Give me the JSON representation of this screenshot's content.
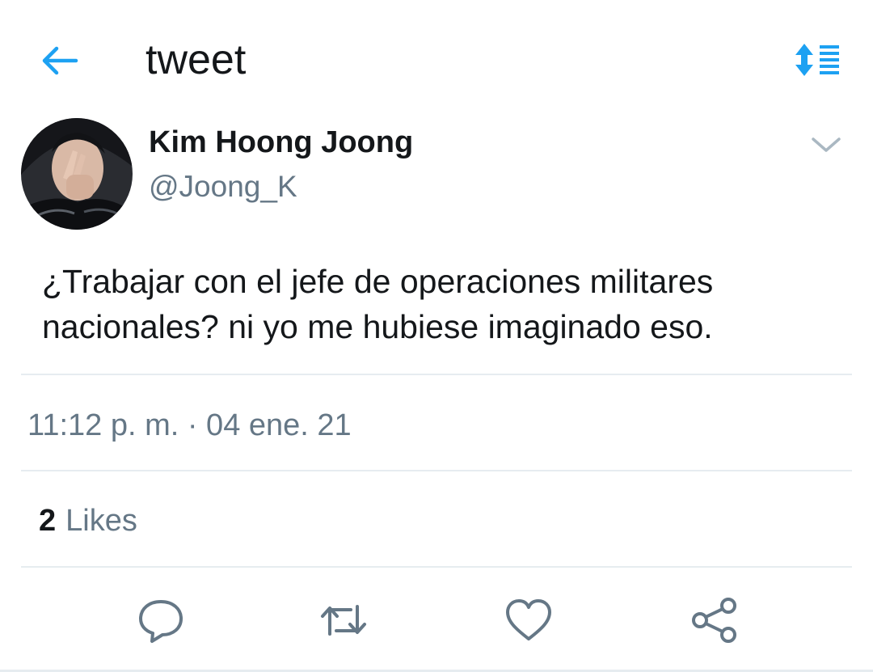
{
  "header": {
    "title": "tweet",
    "back_icon": "arrow-left-icon",
    "sort_icon": "sort-list-icon",
    "accent_color": "#1da1f2"
  },
  "tweet": {
    "author": {
      "name": "Kim Hoong Joong",
      "handle": "@Joong_K",
      "avatar": "profile-photo"
    },
    "text_lines": [
      "¿Trabajar con el jefe de operaciones militares",
      "nacionales? ni yo me hubiese imaginado eso."
    ],
    "timestamp": "11:12 p. m. · 04 ene. 21",
    "likes": {
      "count": "2",
      "label": "Likes"
    }
  },
  "actions": [
    {
      "name": "reply",
      "icon": "reply-icon"
    },
    {
      "name": "retweet",
      "icon": "retweet-icon"
    },
    {
      "name": "like",
      "icon": "heart-icon"
    },
    {
      "name": "share",
      "icon": "share-icon"
    }
  ],
  "colors": {
    "text_primary": "#14171a",
    "text_secondary": "#657786",
    "divider": "#e6ecf0"
  }
}
